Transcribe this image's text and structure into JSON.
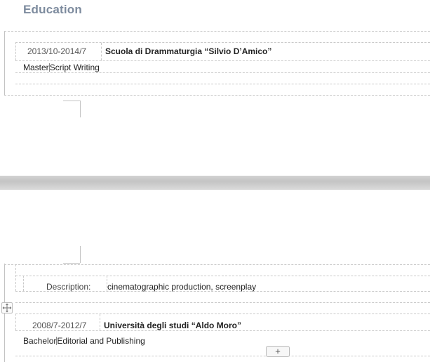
{
  "education": {
    "title": "Education",
    "entries": [
      {
        "date": "2013/10-2014/7",
        "school": "Scuola di Drammaturgia “Silvio D’Amico”",
        "degree": "Master",
        "major": "Script Writing"
      },
      {
        "date": "2008/7-2012/7",
        "school": "Università degli studi “Aldo Moro”",
        "degree": "Bachelor",
        "major": "Editorial and Publishing"
      }
    ],
    "description_label": "Description:",
    "description_value": "cinematographic production, screenplay"
  },
  "controls": {
    "add_row_symbol": "+",
    "move_icon": "move-arrows-icon"
  }
}
